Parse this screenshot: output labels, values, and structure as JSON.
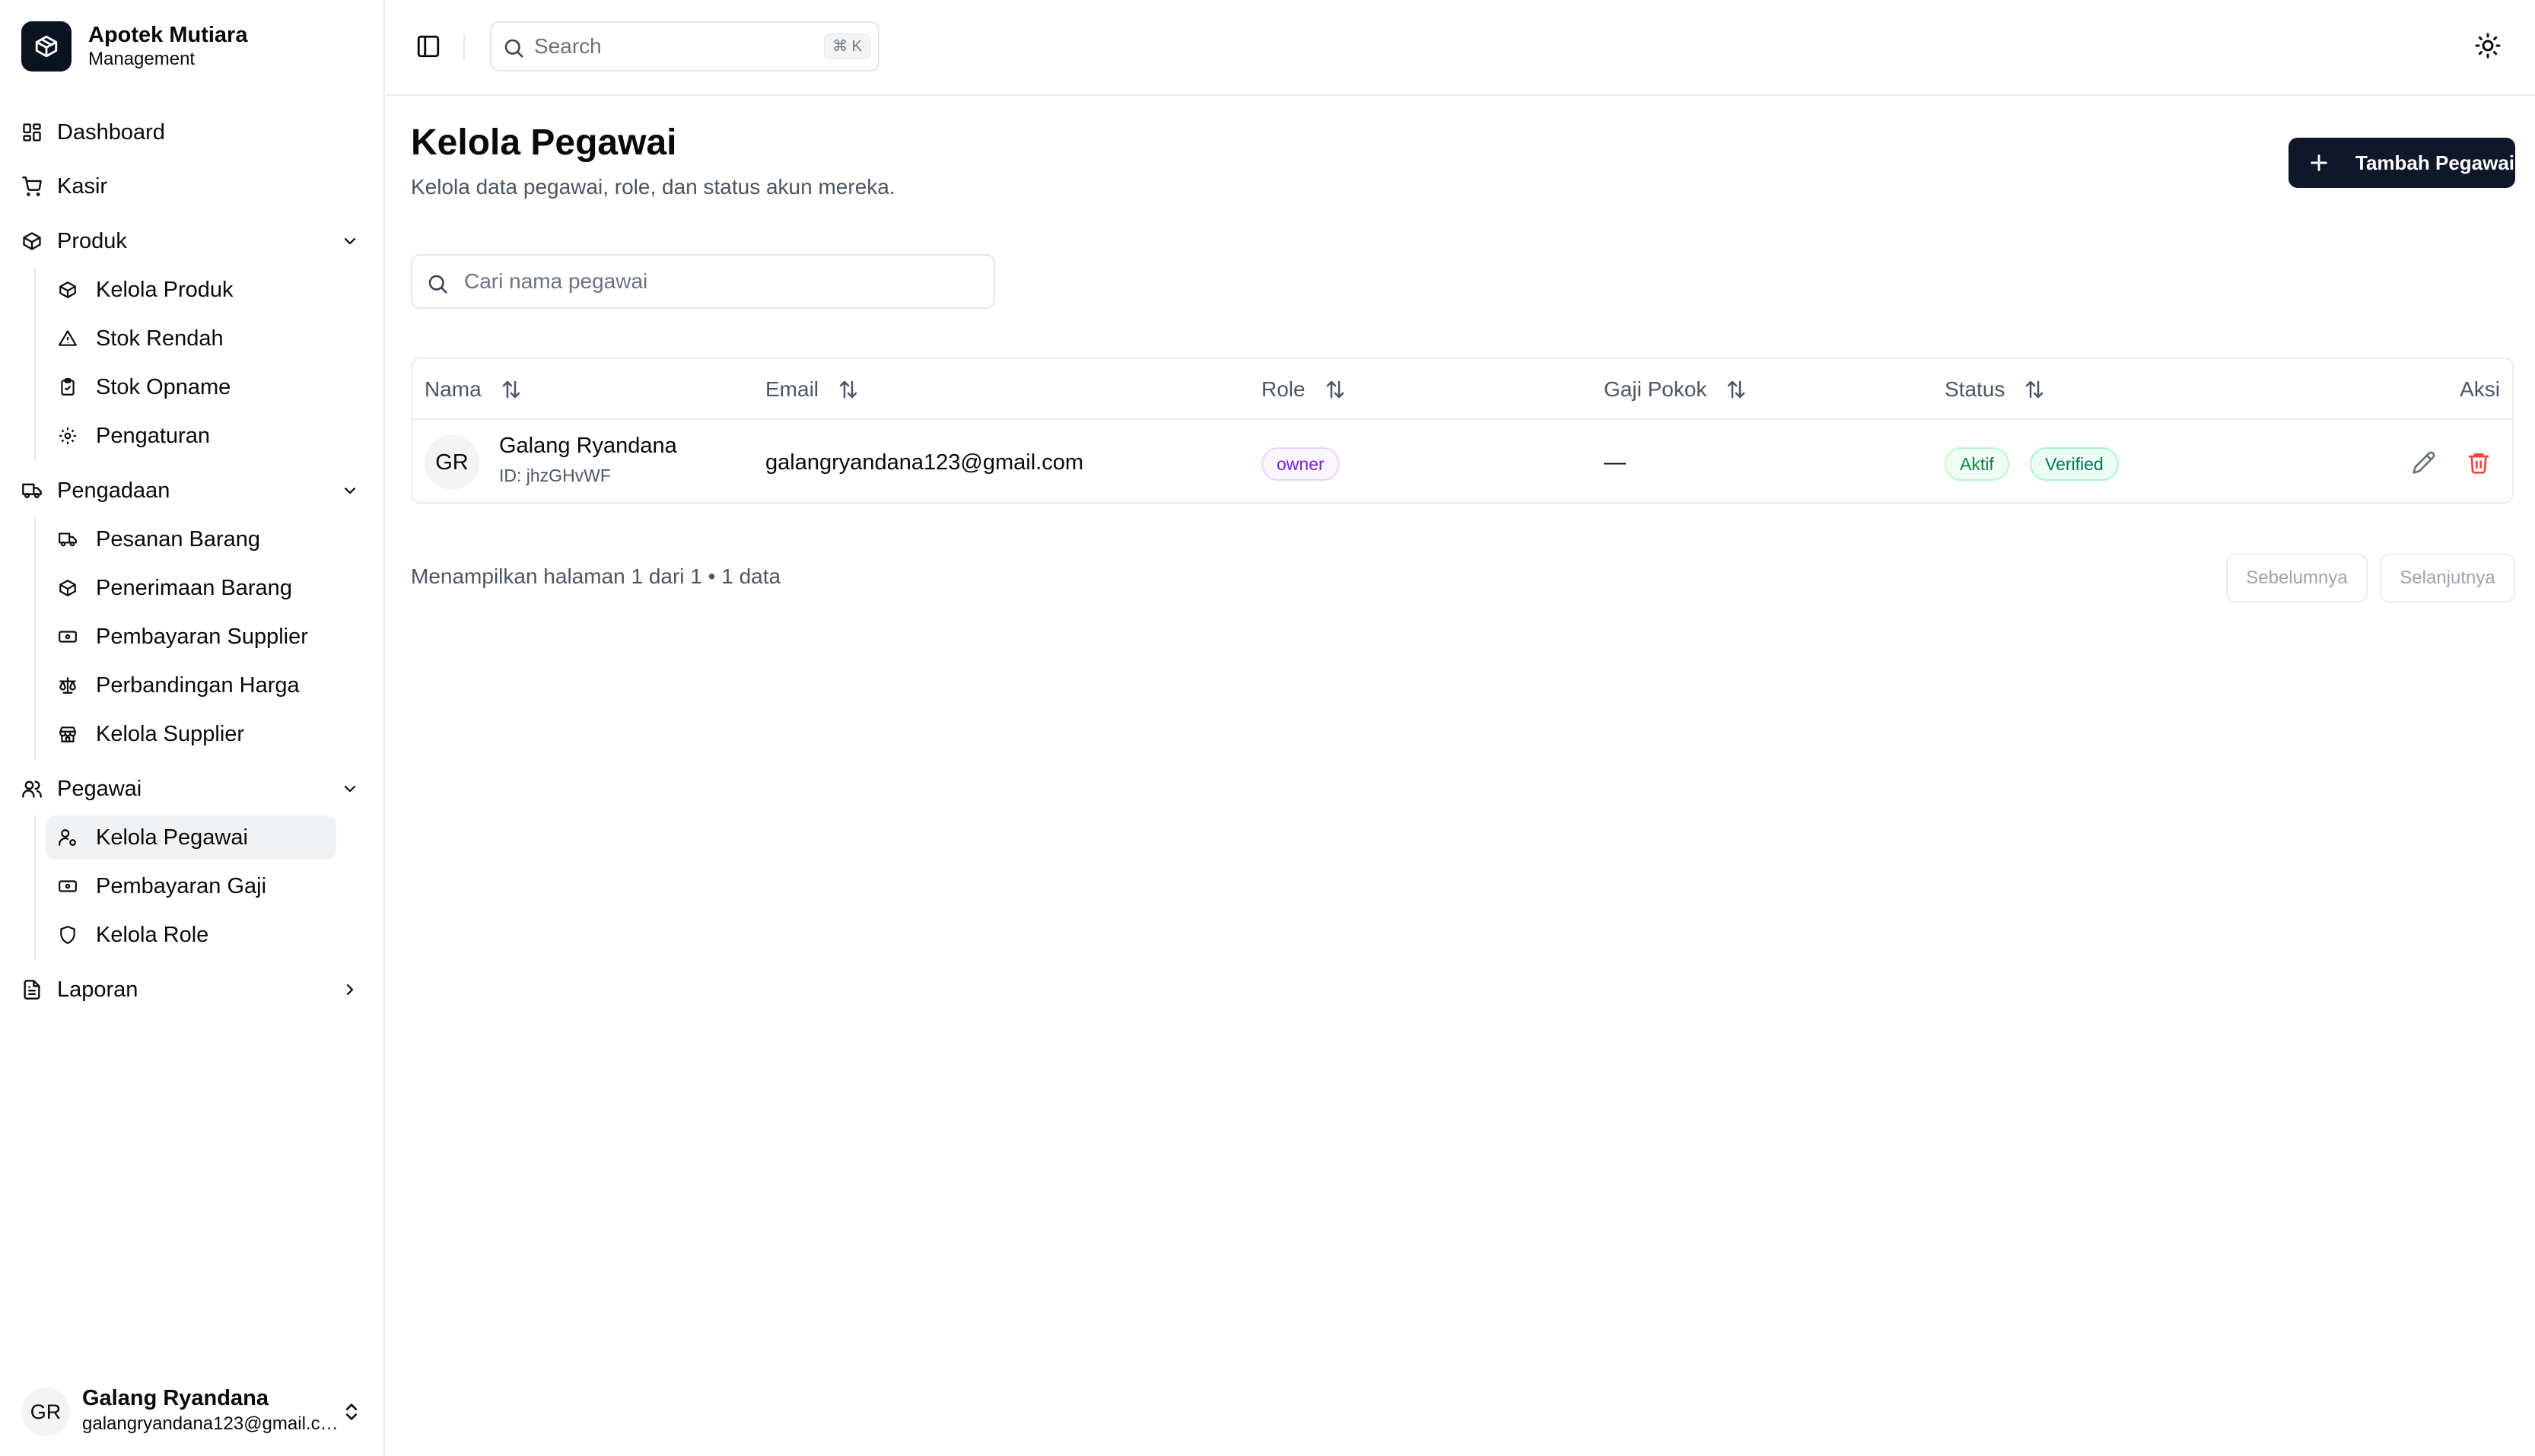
{
  "brand": {
    "name": "Apotek Mutiara",
    "subtitle": "Management"
  },
  "sidebar": {
    "dashboard": "Dashboard",
    "kasir": "Kasir",
    "produk": {
      "label": "Produk",
      "items": [
        "Kelola Produk",
        "Stok Rendah",
        "Stok Opname",
        "Pengaturan"
      ]
    },
    "pengadaan": {
      "label": "Pengadaan",
      "items": [
        "Pesanan Barang",
        "Penerimaan Barang",
        "Pembayaran Supplier",
        "Perbandingan Harga",
        "Kelola Supplier"
      ]
    },
    "pegawai": {
      "label": "Pegawai",
      "items": [
        "Kelola Pegawai",
        "Pembayaran Gaji",
        "Kelola Role"
      ]
    },
    "laporan": "Laporan"
  },
  "user": {
    "initials": "GR",
    "name": "Galang Ryandana",
    "email": "galangryandana123@gmail.com"
  },
  "topbar": {
    "search_placeholder": "Search",
    "shortcut": "⌘ K"
  },
  "page": {
    "title": "Kelola Pegawai",
    "subtitle": "Kelola data pegawai, role, dan status akun mereka.",
    "add_button": "Tambah Pegawai",
    "search_placeholder": "Cari nama pegawai"
  },
  "table": {
    "headers": {
      "name": "Nama",
      "email": "Email",
      "role": "Role",
      "salary": "Gaji Pokok",
      "status": "Status",
      "actions": "Aksi"
    },
    "rows": [
      {
        "initials": "GR",
        "name": "Galang Ryandana",
        "id": "ID: jhzGHvWF",
        "email": "galangryandana123@gmail.com",
        "role": "owner",
        "salary": "—",
        "status": "Aktif",
        "verified": "Verified"
      }
    ]
  },
  "pagination": {
    "info": "Menampilkan halaman 1 dari 1 • 1 data",
    "prev": "Sebelumnya",
    "next": "Selanjutnya"
  },
  "colors": {
    "accent": "#0f172a",
    "danger": "#ef4444"
  }
}
